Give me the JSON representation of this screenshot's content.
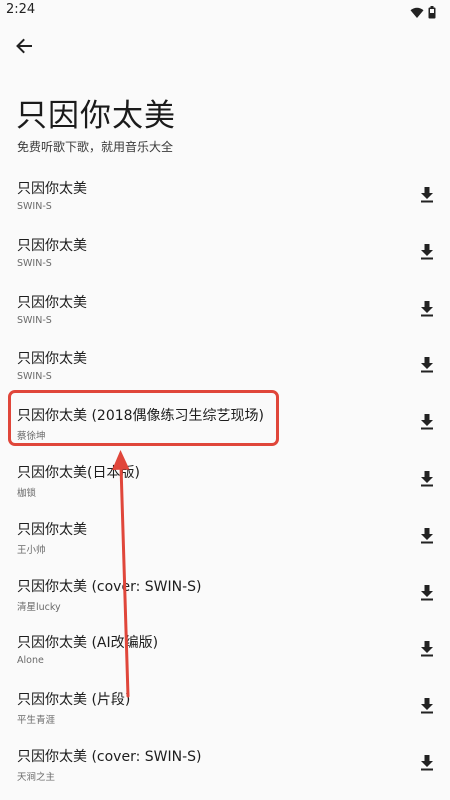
{
  "status_bar": {
    "time": "2:24"
  },
  "header": {
    "title": "只因你太美",
    "subtitle": "免费听歌下歌，就用音乐大全"
  },
  "songs": [
    {
      "title": "只因你太美",
      "artist": "SWIN-S"
    },
    {
      "title": "只因你太美",
      "artist": "SWIN-S"
    },
    {
      "title": "只因你太美",
      "artist": "SWIN-S"
    },
    {
      "title": "只因你太美",
      "artist": "SWIN-S"
    },
    {
      "title": "只因你太美 (2018偶像练习生综艺现场)",
      "artist": "蔡徐坤"
    },
    {
      "title": "只因你太美(日本版)",
      "artist": "枷锁"
    },
    {
      "title": "只因你太美",
      "artist": "王小帅"
    },
    {
      "title": "只因你太美 (cover: SWIN-S)",
      "artist": "清星lucky"
    },
    {
      "title": "只因你太美 (AI改编版)",
      "artist": "Alone"
    },
    {
      "title": "只因你太美 (片段)",
      "artist": "平生青涯"
    },
    {
      "title": "只因你太美 (cover: SWIN-S)",
      "artist": "天涧之主"
    }
  ],
  "icons": {
    "back": "arrow-left-icon",
    "download": "download-icon",
    "wifi": "wifi-icon",
    "battery": "battery-icon"
  },
  "colors": {
    "annotation": "#e0463a",
    "background": "#fafafa"
  }
}
